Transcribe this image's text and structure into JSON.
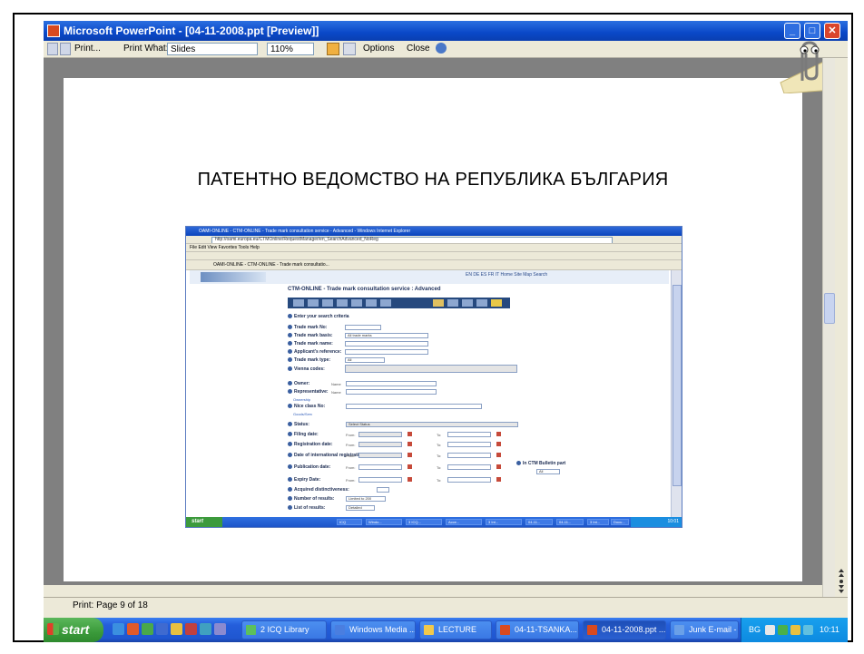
{
  "window": {
    "title": "Microsoft PowerPoint - [04-11-2008.ppt [Preview]]"
  },
  "toolbar": {
    "print_label": "Print...",
    "print_what_label": "Print What:",
    "print_what_value": "Slides",
    "zoom_value": "110%",
    "options_label": "Options",
    "close_label": "Close"
  },
  "slide": {
    "title": "ПАТЕНТНО ВЕДОМСТВО НА РЕПУБЛИКА БЪЛГАРИЯ"
  },
  "inner_browser": {
    "window_title": "OAMI-ONLINE - CTM-ONLINE - Trade mark consultation service - Advanced - Windows Internet Explorer",
    "address": "http://oami.europa.eu/CTMOnline/RequestManager/en_SearchAdvanced_NoReg",
    "menu": "File  Edit  View  Favorites  Tools  Help",
    "tab_title": "OAMI-ONLINE - CTM-ONLINE - Trade mark consultatio...",
    "header_links": "EN  DE  ES  FR  IT   Home   Site Map   Search",
    "page_title": "CTM-ONLINE - Trade mark consultation service : Advanced",
    "section_title": "Enter your search criteria",
    "fields": [
      {
        "label": "Trade mark No:"
      },
      {
        "label": "Trade mark basis:",
        "value": "All trade marks"
      },
      {
        "label": "Trade mark name:"
      },
      {
        "label": "Applicant's reference:"
      },
      {
        "label": "Trade mark type:",
        "value": "All"
      },
      {
        "label": "Vienna codes:"
      },
      {
        "label": "Owner:",
        "sub": "Name"
      },
      {
        "label": "Representative:",
        "sub": "Name"
      },
      {
        "label": "Nice class No:"
      },
      {
        "label": "Status:",
        "value": "Select Status"
      },
      {
        "label": "Filing date:",
        "from": "From:",
        "to": "To:"
      },
      {
        "label": "Registration date:",
        "from": "From:",
        "to": "To:"
      },
      {
        "label": "Date of international registration:",
        "from": "From:",
        "to": "To:"
      },
      {
        "label": "Publication date:",
        "from": "From:",
        "to": "To:"
      },
      {
        "label": "Expiry Date:",
        "from": "From:",
        "to": "To:"
      },
      {
        "label": "Acquired distinctiveness:"
      },
      {
        "label": "Number of results:",
        "value": "Limited to 200"
      },
      {
        "label": "List of results:",
        "value": "Detailed"
      }
    ],
    "owner_link": "Ownership",
    "nice_link": "Goods/Serv",
    "bulletin_label": "In CTM Bulletin part",
    "bulletin_value": "All",
    "taskbar_start": "start",
    "taskbar_items": [
      "ICQ",
      "Windo...",
      "3 ICQ...",
      "Acce...",
      "3 Int...",
      "04-11...",
      "04-11...",
      "3 Int...",
      "Docu..."
    ],
    "taskbar_clock": "10:01"
  },
  "statusbar": {
    "text": "Print: Page 9 of 18"
  },
  "taskbar": {
    "start_label": "start",
    "buttons": [
      {
        "label": "2 ICQ Library"
      },
      {
        "label": "Windows Media ..."
      },
      {
        "label": "LECTURE"
      },
      {
        "label": "04-11-TSANKA..."
      },
      {
        "label": "04-11-2008.ppt ..."
      },
      {
        "label": "Junk E-mail - Mic..."
      }
    ],
    "tray_lang": "BG",
    "clock": "10:11"
  },
  "colors": {
    "titlebar": "#0a48c8",
    "taskbar": "#245edb",
    "start_button": "#3a9a3a",
    "workspace": "#808080"
  }
}
